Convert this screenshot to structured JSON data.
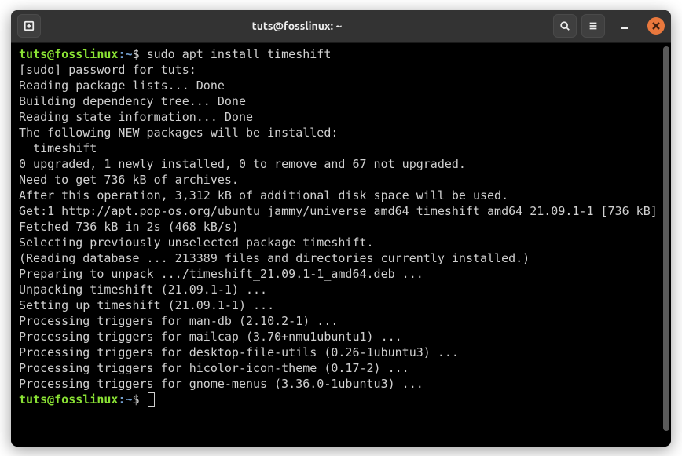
{
  "titlebar": {
    "title": "tuts@fosslinux: ~"
  },
  "prompt": {
    "user_host": "tuts@fosslinux",
    "sep": ":",
    "path": "~",
    "symbol": "$"
  },
  "command": "sudo apt install timeshift",
  "output": [
    "[sudo] password for tuts:",
    "Reading package lists... Done",
    "Building dependency tree... Done",
    "Reading state information... Done",
    "The following NEW packages will be installed:",
    "  timeshift",
    "0 upgraded, 1 newly installed, 0 to remove and 67 not upgraded.",
    "Need to get 736 kB of archives.",
    "After this operation, 3,312 kB of additional disk space will be used.",
    "Get:1 http://apt.pop-os.org/ubuntu jammy/universe amd64 timeshift amd64 21.09.1-1 [736 kB]",
    "Fetched 736 kB in 2s (468 kB/s)",
    "Selecting previously unselected package timeshift.",
    "(Reading database ... 213389 files and directories currently installed.)",
    "Preparing to unpack .../timeshift_21.09.1-1_amd64.deb ...",
    "Unpacking timeshift (21.09.1-1) ...",
    "Setting up timeshift (21.09.1-1) ...",
    "Processing triggers for man-db (2.10.2-1) ...",
    "Processing triggers for mailcap (3.70+nmu1ubuntu1) ...",
    "Processing triggers for desktop-file-utils (0.26-1ubuntu3) ...",
    "Processing triggers for hicolor-icon-theme (0.17-2) ...",
    "Processing triggers for gnome-menus (3.36.0-1ubuntu3) ..."
  ]
}
